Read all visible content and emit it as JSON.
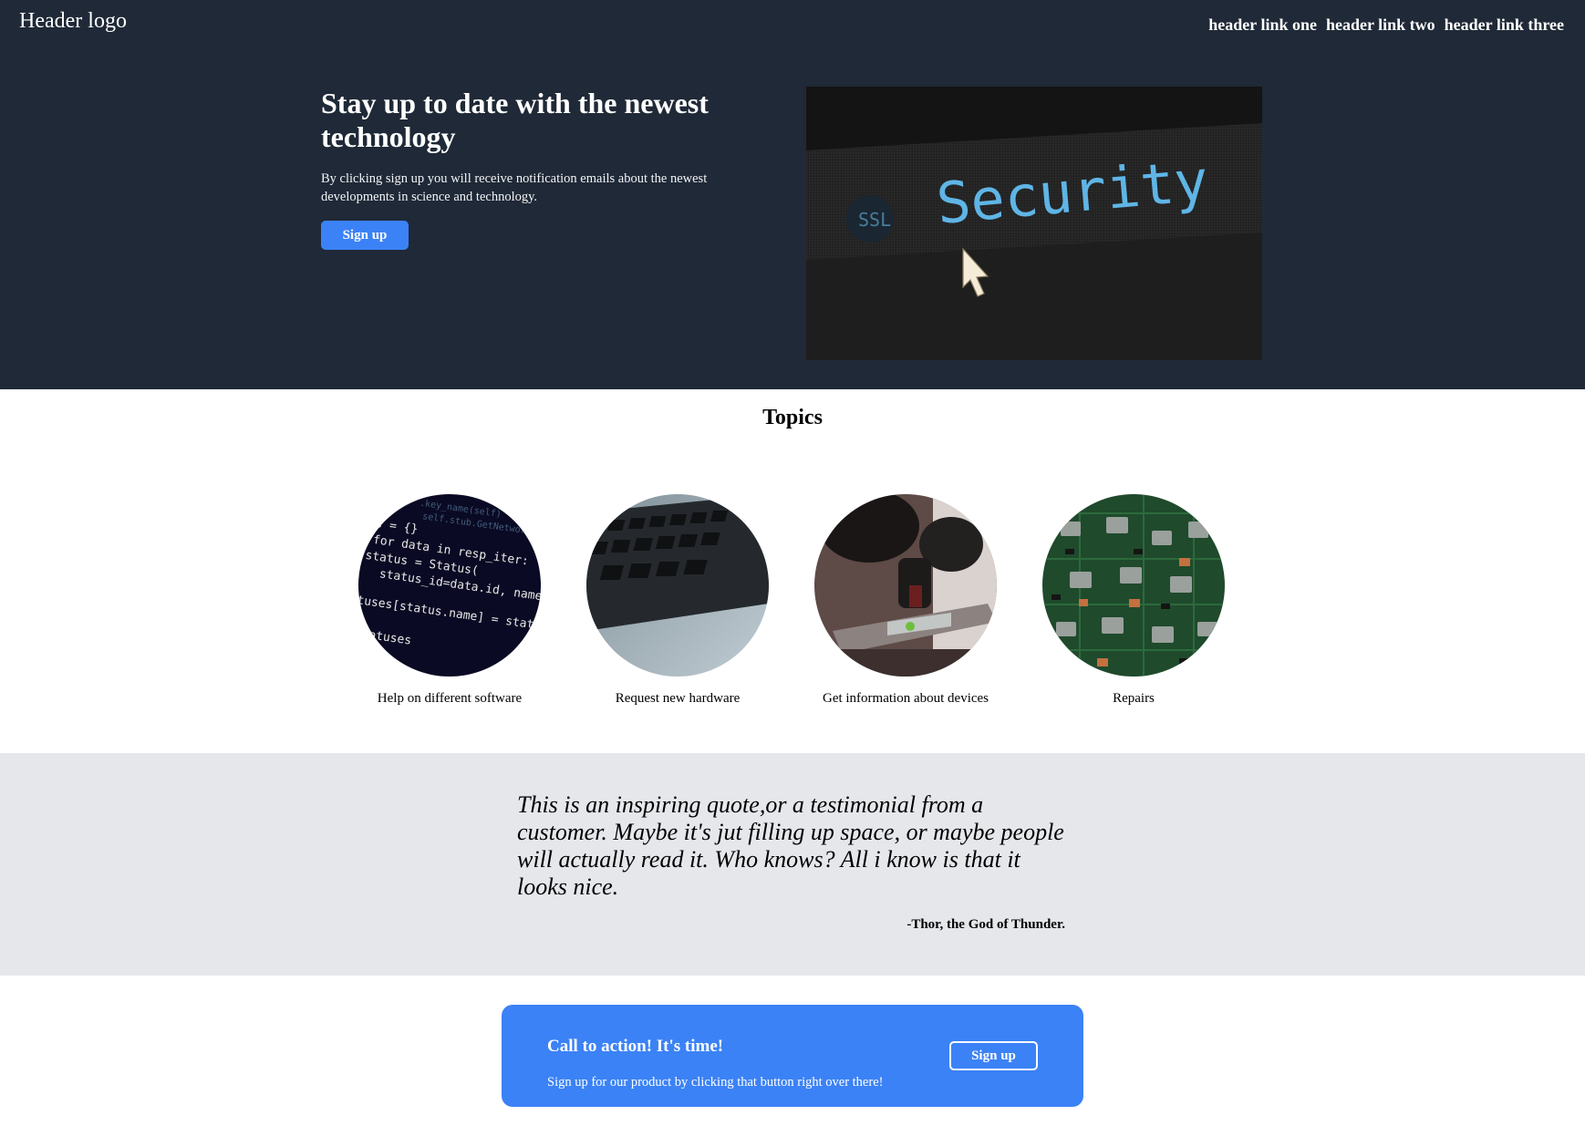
{
  "header": {
    "logo": "Header logo",
    "links": [
      "header link one",
      "header link two",
      "header link three"
    ]
  },
  "hero": {
    "title": "Stay up to date with the newest technology",
    "subtitle": "By clicking sign up you will receive notification emails about the newest developments in science and technology.",
    "button_label": "Sign up",
    "image_text": "Security",
    "image_badge": "SSL"
  },
  "topics": {
    "title": "Topics",
    "items": [
      {
        "caption": "Help on different software"
      },
      {
        "caption": "Request new hardware"
      },
      {
        "caption": "Get information about devices"
      },
      {
        "caption": "Repairs"
      }
    ],
    "code_lines": [
      "s = {}",
      "for data in resp_iter:",
      "status = Status(",
      "status_id=data.id, name=data",
      "atuses[status.name] = status",
      "atuses"
    ]
  },
  "quote": {
    "text": "This is an inspiring quote,or a testimonial from a customer. Maybe it's jut filling up space, or maybe people will actually read it. Who knows? All i know is that it looks nice.",
    "author": "-Thor, the God of Thunder."
  },
  "cta": {
    "title": "Call to action! It's time!",
    "subtitle": "Sign up for our product by clicking that button right over there!",
    "button_label": "Sign up"
  },
  "colors": {
    "dark": "#1f2937",
    "accent": "#3b82f6",
    "quote_bg": "#e5e7eb"
  }
}
